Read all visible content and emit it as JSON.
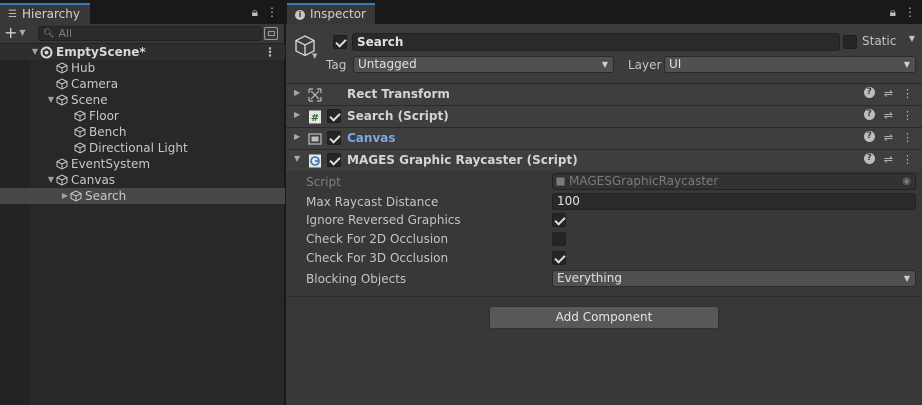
{
  "hierarchy": {
    "tab_label": "Hierarchy",
    "search_placeholder": "All",
    "scene_name": "EmptyScene*",
    "items": [
      {
        "label": "Hub"
      },
      {
        "label": "Camera"
      },
      {
        "label": "Scene"
      },
      {
        "label": "Floor"
      },
      {
        "label": "Bench"
      },
      {
        "label": "Directional Light"
      },
      {
        "label": "EventSystem"
      },
      {
        "label": "Canvas"
      },
      {
        "label": "Search"
      }
    ]
  },
  "inspector": {
    "tab_label": "Inspector",
    "object_name": "Search",
    "static_label": "Static",
    "tag_label": "Tag",
    "tag_value": "Untagged",
    "layer_label": "Layer",
    "layer_value": "UI",
    "components": [
      {
        "title": "Rect Transform"
      },
      {
        "title": "Search (Script)"
      },
      {
        "title": "Canvas"
      },
      {
        "title": "MAGES Graphic Raycaster (Script)"
      }
    ],
    "raycaster_props": {
      "script_label": "Script",
      "script_value": "MAGESGraphicRaycaster",
      "max_raycast_label": "Max Raycast Distance",
      "max_raycast_value": "100",
      "ignore_reversed_label": "Ignore Reversed Graphics",
      "ignore_reversed_checked": true,
      "check_2d_label": "Check For 2D Occlusion",
      "check_2d_checked": false,
      "check_3d_label": "Check For 3D Occlusion",
      "check_3d_checked": true,
      "blocking_label": "Blocking Objects",
      "blocking_value": "Everything"
    },
    "add_component_label": "Add Component"
  },
  "colors": {
    "selection": "#474747",
    "accent_tab": "#3a79bb",
    "link_blue": "#7fa6e2"
  }
}
